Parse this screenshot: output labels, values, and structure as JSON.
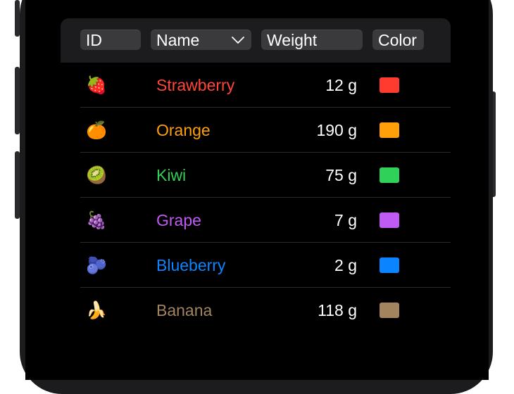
{
  "table": {
    "columns": {
      "id": "ID",
      "name": "Name",
      "weight": "Weight",
      "color": "Color"
    },
    "rows": [
      {
        "emoji": "🍓",
        "name": "Strawberry",
        "weight": "12 g",
        "color": "#ff3b30",
        "name_color": "#ff453a"
      },
      {
        "emoji": "🍊",
        "name": "Orange",
        "weight": "190 g",
        "color": "#ff9f0a",
        "name_color": "#ff9f0a"
      },
      {
        "emoji": "🥝",
        "name": "Kiwi",
        "weight": "75 g",
        "color": "#30d158",
        "name_color": "#30d158"
      },
      {
        "emoji": "🍇",
        "name": "Grape",
        "weight": "7 g",
        "color": "#bf5af2",
        "name_color": "#bf5af2"
      },
      {
        "emoji": "🫐",
        "name": "Blueberry",
        "weight": "2 g",
        "color": "#0a84ff",
        "name_color": "#0a84ff"
      },
      {
        "emoji": "🍌",
        "name": "Banana",
        "weight": "118 g",
        "color": "#a2845e",
        "name_color": "#a2845e"
      }
    ]
  }
}
